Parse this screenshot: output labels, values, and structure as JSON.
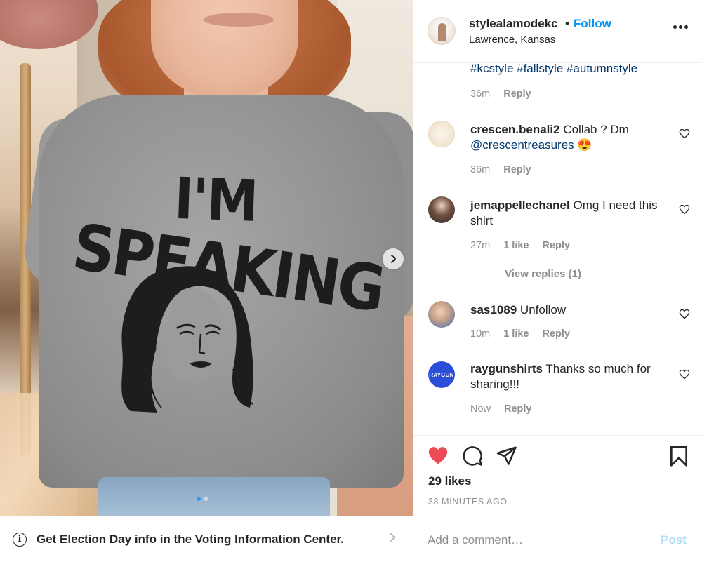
{
  "photo": {
    "print_line1": "I'M",
    "print_line2": "SPEAKING",
    "carousel_total": 2,
    "carousel_active": 1
  },
  "voting_banner": {
    "info_glyph": "i",
    "text": "Get Election Day info in the Voting Information Center."
  },
  "header": {
    "username": "stylealamodekc",
    "separator": "•",
    "follow_label": "Follow",
    "location": "Lawrence, Kansas"
  },
  "caption": {
    "hashtags": "#kcstyle #fallstyle #autumnstyle",
    "time": "36m",
    "reply_label": "Reply"
  },
  "comments": [
    {
      "username": "crescen.benali2",
      "text": "Collab ? Dm",
      "mention": "@crescentreasures",
      "emoji": "😍",
      "time": "36m",
      "likes": "",
      "reply_label": "Reply"
    },
    {
      "username": "jemappellechanel",
      "text": "Omg I need this shirt",
      "mention": "",
      "emoji": "",
      "time": "27m",
      "likes": "1 like",
      "reply_label": "Reply"
    },
    {
      "username": "sas1089",
      "text": "Unfollow",
      "mention": "",
      "emoji": "",
      "time": "10m",
      "likes": "1 like",
      "reply_label": "Reply"
    },
    {
      "username": "raygunshirts",
      "text": "Thanks so much for sharing!!!",
      "mention": "",
      "emoji": "",
      "time": "Now",
      "likes": "",
      "reply_label": "Reply"
    }
  ],
  "raygun_avatar_text": "RAYGUN",
  "view_replies_label": "View replies (1)",
  "actions": {
    "likes": "29 likes",
    "posted": "38 MINUTES AGO",
    "like_color": "#ed4956"
  },
  "add_comment": {
    "placeholder": "Add a comment…",
    "post_label": "Post"
  },
  "colors": {
    "link_blue": "#0095f6",
    "hashtag_blue": "#00376b",
    "muted_gray": "#8e8e8e"
  }
}
